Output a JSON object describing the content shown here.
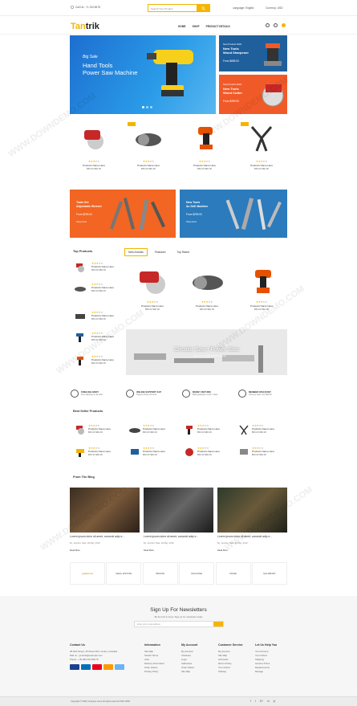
{
  "topbar": {
    "call": "Call Us : +1 234 5678",
    "search_placeholder": "Search Your Product",
    "language": "Language: English",
    "currency": "Currency: USD"
  },
  "header": {
    "logo_prefix": "Tan",
    "logo_suffix": "trik",
    "nav": [
      "HOME",
      "SHOP",
      "PRODUCT DETAILS"
    ]
  },
  "hero": {
    "tagline": "Big Sale",
    "title_line1": "Hand Tools",
    "title_line2": "Power Saw Machine"
  },
  "side_banners": [
    {
      "kicker": "New Product 2018",
      "line1": "New Tools",
      "line2": "Wood Sharpener",
      "price": "From $689.00"
    },
    {
      "kicker": "New Product 2018",
      "line1": "New Tools",
      "line2": "Wood Cutter",
      "price": "From $399.00"
    }
  ],
  "products_row": [
    {
      "name": "Products Name Here",
      "price": "$56.00  $60.00"
    },
    {
      "name": "Products Name Here",
      "price": "$56.00  $60.00"
    },
    {
      "name": "Products Name Here",
      "price": "$56.00  $60.00"
    },
    {
      "name": "Products Name Here",
      "price": "$56.00  $60.00"
    }
  ],
  "promo_banners": [
    {
      "line1": "Tools Set",
      "line2": "Adjustable Wrench",
      "price": "From $299.00",
      "cta": "Shop Now"
    },
    {
      "line1": "New Tools",
      "line2": "Ac Drill Machine",
      "price": "From $299.00",
      "cta": "Shop Now"
    }
  ],
  "top_products": {
    "title": "Top Products",
    "items": [
      {
        "name": "Products Name Here",
        "price": "$56.00  $60.00"
      },
      {
        "name": "Products Name Here",
        "price": "$56.00  $60.00"
      },
      {
        "name": "Products Name Here",
        "price": "$56.00  $60.00"
      },
      {
        "name": "Products Name Here",
        "price": "$56.00  $60.00"
      },
      {
        "name": "Products Name Here",
        "price": "$56.00  $60.00"
      }
    ]
  },
  "tabs": [
    "New Arrivals",
    "Featured",
    "Top Rated"
  ],
  "tab_products": [
    {
      "name": "Products Name Here",
      "price": "$56.00  $60.00"
    },
    {
      "name": "Products Name Here",
      "price": "$56.00  $60.00"
    },
    {
      "name": "Products Name Here",
      "price": "$56.00  $60.00"
    }
  ],
  "circular": {
    "title": "Circular Saw / Power Saw",
    "sub": "Save up to 20% Off This Week"
  },
  "features": [
    {
      "title": "FREE DELIVERY",
      "sub": "Free shipping on all order"
    },
    {
      "title": "ONLINE SUPPORT 24/7",
      "sub": "Support online 24 hours"
    },
    {
      "title": "MONEY RETURN",
      "sub": "Back guarantee under 7 days"
    },
    {
      "title": "MEMBER DISCOUNT",
      "sub": "Onevery order over $30.00"
    }
  ],
  "best_seller": {
    "title": "Best Seller Products",
    "items": [
      {
        "name": "Products Name Here",
        "price": "$56.00  $60.00"
      },
      {
        "name": "Products Name Here",
        "price": "$56.00  $60.00"
      },
      {
        "name": "Products Name Here",
        "price": "$56.00  $60.00"
      },
      {
        "name": "Products Name Here",
        "price": "$56.00  $60.00"
      },
      {
        "name": "Products Name Here",
        "price": "$56.00  $60.00"
      },
      {
        "name": "Products Name Here",
        "price": "$56.00  $60.00"
      },
      {
        "name": "Products Name Here",
        "price": "$56.00  $60.00"
      },
      {
        "name": "Products Name Here",
        "price": "$56.00  $60.00"
      }
    ]
  },
  "blog": {
    "title": "From The Blog",
    "posts": [
      {
        "title": "Lorem ipsum dolor sit amet, consecti adip e...",
        "meta": "By: Jennifer, Date: 28 May, 2018",
        "more": "Read More"
      },
      {
        "title": "Lorem ipsum dolor sit amet, consecti adip e...",
        "meta": "By: Jennifer, Date: 28 May, 2018",
        "more": "Read More"
      },
      {
        "title": "Lorem ipsum dolor sit amet, consecti adip e...",
        "meta": "By: Jennifer, Date: 28 May, 2018",
        "more": "Read More"
      }
    ]
  },
  "brands": [
    "goldenrod",
    "REAL ESTATE",
    "BRAND",
    "MACHINE",
    "MADE",
    "SALSBURY"
  ],
  "newsletter": {
    "title": "Sign Up For Newsletters",
    "sub": "Be the first to know. Sign up for newsletter today",
    "placeholder": "Enter your email address"
  },
  "footer": {
    "contact": {
      "title": "Contact Us",
      "address": "28 Web Street, 25 Street SW, London, Australia",
      "email": "Mail us : yourinfo@example.com",
      "phone": "Phone: + 00 284 234 658 78"
    },
    "columns": [
      {
        "title": "Information",
        "links": [
          "Site Map",
          "Search Terms",
          "Jobs",
          "Delivery Information",
          "Order History",
          "Privacy Policy"
        ]
      },
      {
        "title": "My Account",
        "links": [
          "My Account",
          "Checkout",
          "Login",
          "Addresses",
          "Order Status",
          "Site Map"
        ]
      },
      {
        "title": "Customer Service",
        "links": [
          "My Account",
          "Site Map",
          "Gift Cards",
          "Return Policy",
          "Your Orders",
          "Subway"
        ]
      },
      {
        "title": "Let Us Help You",
        "links": [
          "Your Account",
          "Your Orders",
          "Shipping",
          "Amazon Prime",
          "Replacements",
          "Manage"
        ]
      }
    ],
    "payment_colors": [
      "#1a3f8f",
      "#0070ba",
      "#eb001b",
      "#ff9900",
      "#6db3f2"
    ]
  },
  "copyright": "Copyright © 2020 Company name All rights reserved ITEO 2018",
  "social": [
    "f",
    "t",
    "G+",
    "in",
    "yt"
  ],
  "watermark": "WWW.DOWNDEMO.COM",
  "colors": {
    "accent": "#f4b400",
    "hero_blue": "#1d6fd0",
    "orange": "#f05a28",
    "navy": "#1f5f9c"
  }
}
